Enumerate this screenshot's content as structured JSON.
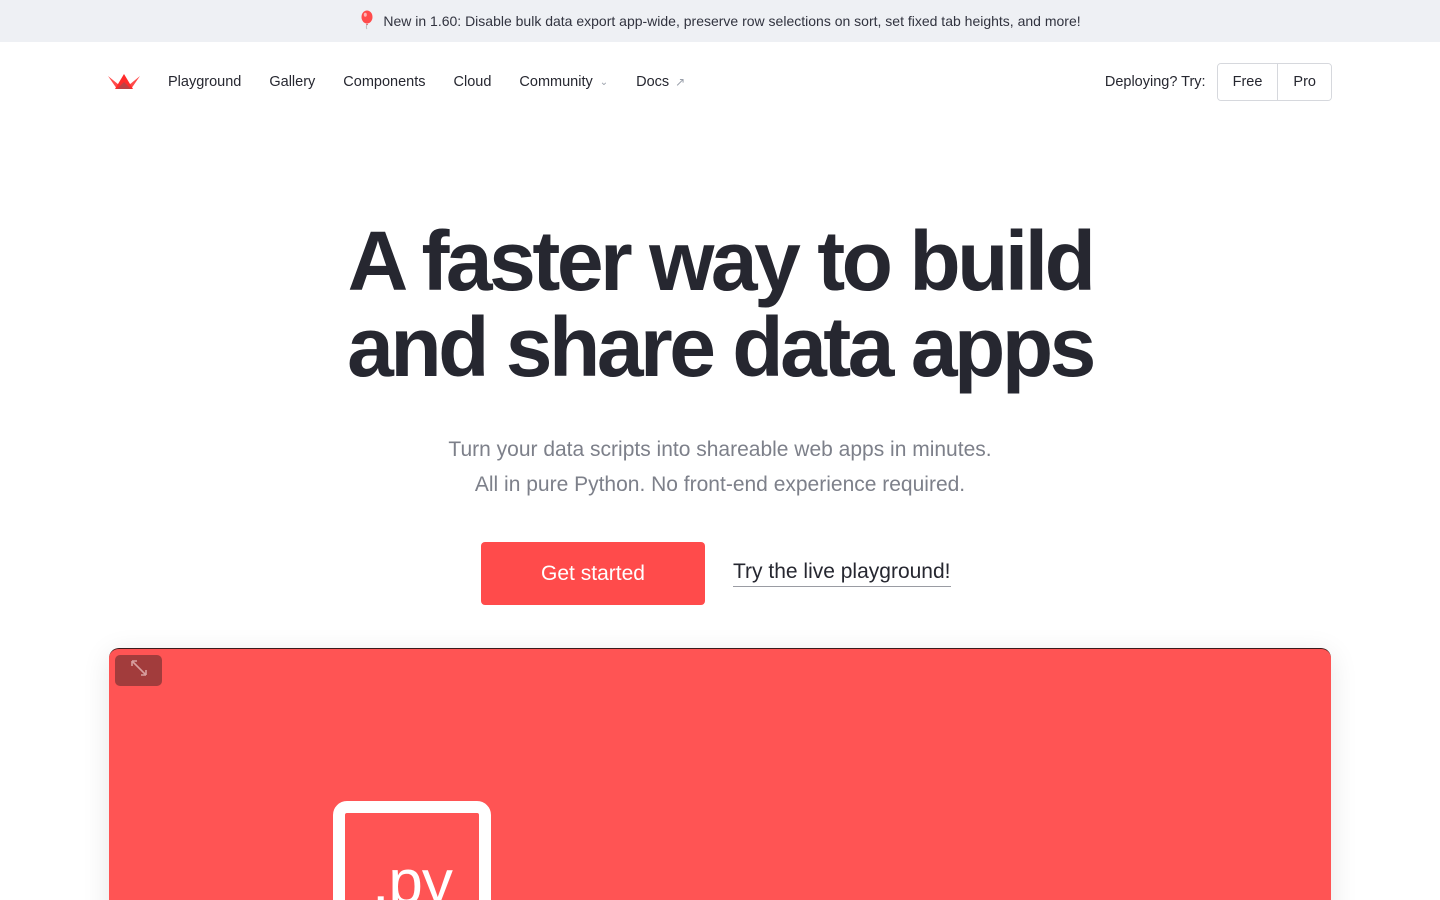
{
  "announcement": {
    "icon": "balloon-icon",
    "text": "New in 1.60: Disable bulk data export app-wide, preserve row selections on sort, set fixed tab heights, and more!"
  },
  "nav": {
    "logo": "streamlit-crown-logo",
    "links": [
      {
        "label": "Playground"
      },
      {
        "label": "Gallery"
      },
      {
        "label": "Components"
      },
      {
        "label": "Cloud"
      },
      {
        "label": "Community",
        "icon": "chevron-down-icon"
      },
      {
        "label": "Docs",
        "icon": "external-link-icon"
      }
    ],
    "deploy_label": "Deploying? Try:",
    "deploy_options": [
      "Free",
      "Pro"
    ]
  },
  "hero": {
    "title_line1": "A faster way to build",
    "title_line2": "and share data apps",
    "subtitle_line1": "Turn your data scripts into shareable web apps in minutes.",
    "subtitle_line2": "All in pure Python. No front-end experience required.",
    "primary_cta": "Get started",
    "secondary_cta": "Try the live playground!"
  },
  "demo": {
    "expand_icon": "expand-icon",
    "file_label": ".py"
  },
  "colors": {
    "brand": "#ff4b4b",
    "panel": "#ff5454",
    "text": "#262730",
    "muted": "#7d808a",
    "announce_bg": "#eef0f4"
  }
}
